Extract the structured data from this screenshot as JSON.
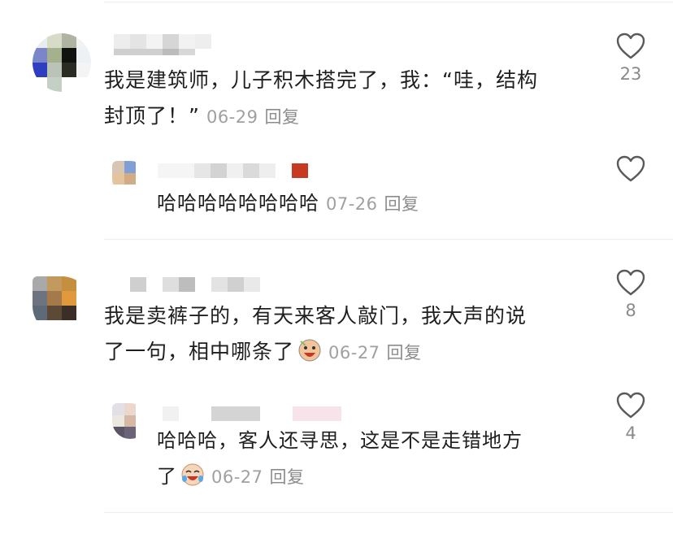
{
  "comments": [
    {
      "text_line1": "我是建筑师，儿子积木搭完了，我：“哇，结构",
      "text_line2": "封顶了！”",
      "date": "06-29",
      "reply_label": "回复",
      "likes": "23"
    },
    {
      "text_line1": "哈哈哈哈哈哈哈哈",
      "date": "07-26",
      "reply_label": "回复",
      "likes": ""
    },
    {
      "text_line1": "我是卖裤子的，有天来客人敲门，我大声的说",
      "text_line2": "了一句，相中哪条了",
      "date": "06-27",
      "reply_label": "回复",
      "likes": "8",
      "emoji": "crying-emoji"
    },
    {
      "text_line1": "哈哈哈，客人还寻思，这是不是走错地方",
      "text_line2": "了",
      "date": "06-27",
      "reply_label": "回复",
      "likes": "4",
      "emoji": "laughing-tears-emoji"
    }
  ],
  "icons": {
    "like": "heart-icon"
  },
  "colors": {
    "meta": "#a0a0a0",
    "text": "#1f1f1f",
    "divider": "#ececec"
  }
}
